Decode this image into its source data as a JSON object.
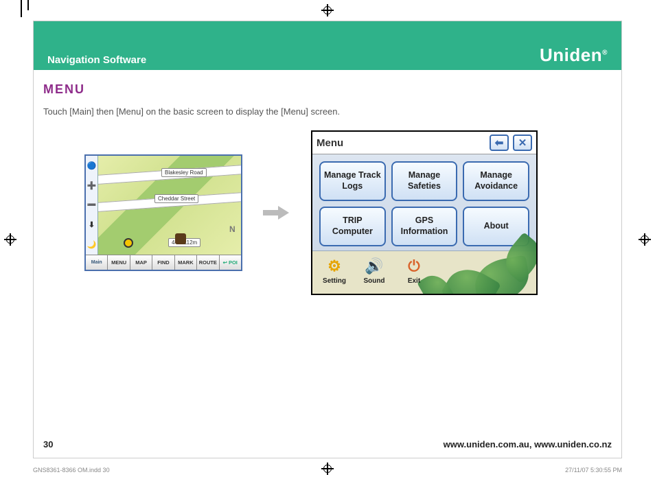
{
  "header": {
    "section": "Navigation Software",
    "brand": "Uniden"
  },
  "heading": "MENU",
  "intro": "Touch [Main] then [Menu] on the basic screen to display the [Menu] screen.",
  "map": {
    "road1": "Blakesley Road",
    "road2": "Cheddar Street",
    "dist": "44m  112m",
    "compass": "N",
    "sidebar_icons": [
      "🔵",
      "➕",
      "➖",
      "⬇",
      "🌙"
    ],
    "buttons": [
      "Main",
      "MENU",
      "MAP",
      "FIND",
      "MARK",
      "ROUTE",
      "↩ POI"
    ]
  },
  "menu_screen": {
    "title": "Menu",
    "back_arrow": "⬅",
    "close": "✕",
    "items": [
      "Manage Track Logs",
      "Manage Safeties",
      "Manage Avoidance",
      "TRIP Computer",
      "GPS Information",
      "About"
    ],
    "bottom": {
      "setting": "Setting",
      "sound": "Sound",
      "exit": "Exit"
    }
  },
  "footer": {
    "page": "30",
    "urls": "www.uniden.com.au, www.uniden.co.nz"
  },
  "slug": {
    "file": "GNS8361-8366 OM.indd   30",
    "timestamp": "27/11/07   5:30:55 PM"
  }
}
